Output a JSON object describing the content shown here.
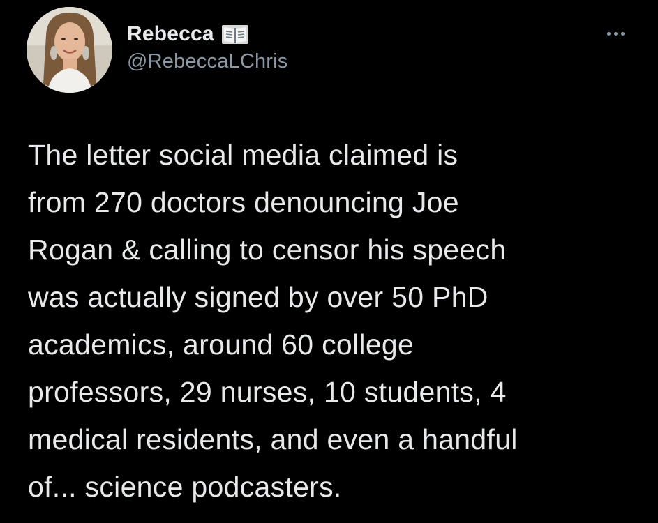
{
  "tweet": {
    "author": {
      "display_name": "Rebecca",
      "name_emoji_icon": "open-book-icon",
      "handle": "@RebeccaLChris"
    },
    "more_icon": "more-horizontal-icon",
    "text": "The letter social media claimed is\nfrom 270 doctors denouncing Joe\nRogan & calling to censor his speech\nwas actually signed by over 50 PhD\nacademics, around 60 college\nprofessors, 29 nurses, 10 students, 4\nmedical residents, and even a handful\nof... science podcasters."
  },
  "colors": {
    "background": "#000000",
    "primary_text": "#e7e9ea",
    "secondary_text": "#8b98a5"
  }
}
